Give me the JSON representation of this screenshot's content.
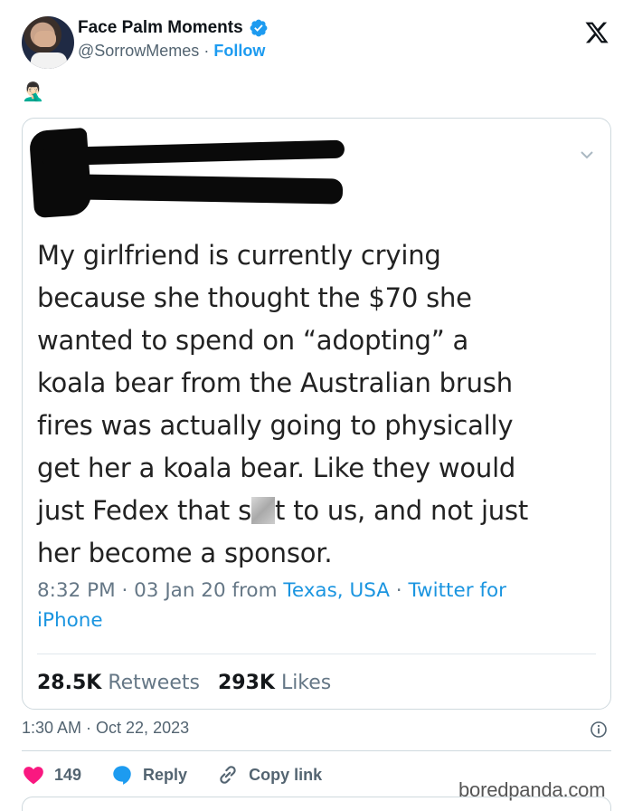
{
  "author": {
    "display_name": "Face Palm Moments",
    "handle": "@SorrowMemes",
    "separator": "·",
    "follow_label": "Follow"
  },
  "post_emoji": "🤦🏻‍♂️",
  "quoted_tweet": {
    "text_before": "My girlfriend is currently crying\nbecause she thought the $70 she\nwanted to spend on “adopting” a\nkoala bear from the Australian brush\nfires was actually going to physically\nget her a koala bear. Like they would\njust Fedex that s",
    "text_after": "t to us, and not just\nher become a sponsor.",
    "time_date": "8:32 PM · 03 Jan 20 from ",
    "location": "Texas, USA",
    "dot": " · ",
    "client": "Twitter for\niPhone",
    "retweets_count": "28.5K",
    "retweets_label": "Retweets",
    "likes_count": "293K",
    "likes_label": "Likes"
  },
  "timestamp": "1:30 AM · Oct 22, 2023",
  "actions": {
    "like_count": "149",
    "reply_label": "Reply",
    "copy_link_label": "Copy link"
  },
  "watermark": "boredpanda.com",
  "colors": {
    "accent": "#1d9bf0",
    "like": "#f91880",
    "link": "#1b95e0"
  }
}
